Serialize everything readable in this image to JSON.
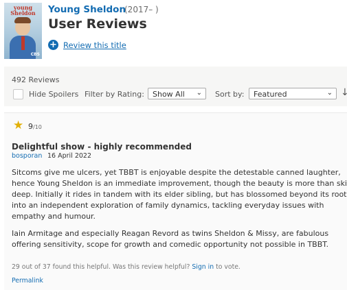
{
  "header": {
    "poster": {
      "logo_line1": "young",
      "logo_line2": "Sheldon",
      "network": "CBS"
    },
    "series_title": "Young Sheldon",
    "series_years": "(2017– )",
    "page_title": "User Reviews",
    "review_link": "Review this title"
  },
  "filters": {
    "count": "492 Reviews",
    "hide_spoilers": "Hide Spoilers",
    "filter_label": "Filter by Rating:",
    "rating_value": "Show All",
    "sort_label": "Sort by:",
    "sort_value": "Featured"
  },
  "review": {
    "rating": "9",
    "rating_of": "/10",
    "title": "Delightful show - highly recommended",
    "author": "bosporan",
    "date": "16 April 2022",
    "paragraph1": "Sitcoms give me ulcers, yet TBBT is enjoyable despite the detestable canned laughter,\nhence Young Sheldon is an immediate improvement, though the beauty is more than skin\ndeep. Initially it rides in tandem with its elder sibling, but has blossomed beyond its roots\ninto an independent exploration of family dynamics, tackling everyday issues with\nempathy and humour.",
    "paragraph2": "Iain Armitage and especially Reagan Revord as twins Sheldon & Missy, are fabulous\noffering sensitivity, scope for growth and comedic opportunity not possible in TBBT.",
    "helpful_text": "29 out of 37 found this helpful. Was this review helpful?",
    "sign_in": "Sign in",
    "to_vote": "to vote.",
    "permalink": "Permalink"
  },
  "colors": {
    "link": "#136cb2",
    "star": "#e2b007",
    "panel": "#f6f6f5"
  }
}
